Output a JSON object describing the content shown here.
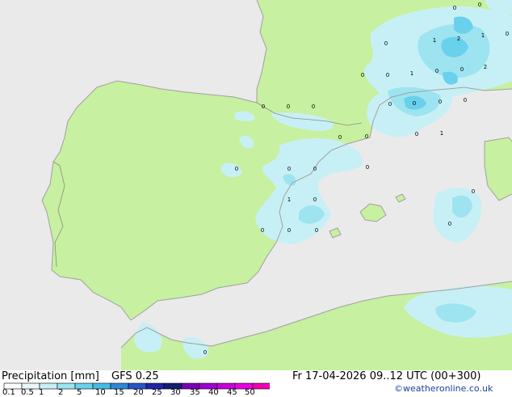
{
  "footer": {
    "title": "Precipitation [mm]",
    "model": "GFS 0.25",
    "valid_time": "Fr 17-04-2026 09..12 UTC (00+300)",
    "credit": "©weatheronline.co.uk"
  },
  "legend": {
    "ticks": [
      "0.1",
      "0.5",
      "1",
      "2",
      "5",
      "10",
      "15",
      "20",
      "25",
      "30",
      "35",
      "40",
      "45",
      "50"
    ],
    "colors": [
      "#ffffff",
      "#e9f9fb",
      "#c7f0f6",
      "#9de4f0",
      "#69d1eb",
      "#42bde6",
      "#2f86d8",
      "#2a55c8",
      "#1f25a8",
      "#122070",
      "#7a00b8",
      "#a000d0",
      "#c800d8",
      "#e600e0",
      "#f000b0"
    ]
  },
  "map": {
    "land_color": "#c7f0a0",
    "sea_color": "#eaeaea",
    "precip_colors": {
      "light": "#c7f0f6",
      "medium": "#9de4f0",
      "heavy": "#69d1eb",
      "heaviest": "#42bde6"
    },
    "point_values": [
      "0",
      "1",
      "2",
      "1",
      "0",
      "0",
      "0",
      "0",
      "0",
      "1",
      "0",
      "0",
      "2",
      "0",
      "0",
      "0",
      "0",
      "1",
      "0",
      "0",
      "0",
      "0",
      "0",
      "0",
      "0",
      "0",
      "0",
      "0",
      "1",
      "0",
      "0",
      "0",
      "0",
      "0",
      "0",
      "0"
    ]
  }
}
